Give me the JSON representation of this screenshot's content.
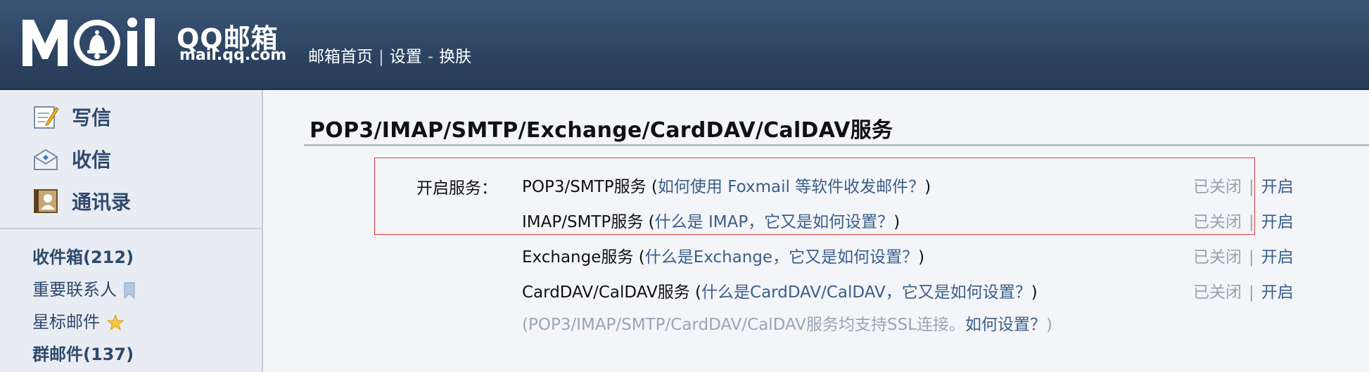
{
  "header": {
    "logo_text": "MOIL",
    "logo_cn": "QQ邮箱",
    "logo_domain": "mail.qq.com",
    "nav": [
      "邮箱首页",
      "设置",
      "换肤"
    ],
    "nav_sep_1": "|",
    "nav_sep_2": "-"
  },
  "sidebar": {
    "actions": [
      {
        "label": "写信",
        "icon": "compose-icon"
      },
      {
        "label": "收信",
        "icon": "inbox-envelope-icon"
      },
      {
        "label": "通讯录",
        "icon": "contacts-icon"
      }
    ],
    "folders": [
      {
        "label": "收件箱(212)",
        "bold": true
      },
      {
        "label": "重要联系人",
        "bold": false,
        "icon": "bookmark-icon"
      },
      {
        "label": "星标邮件",
        "bold": false,
        "icon": "star-icon"
      },
      {
        "label": "群邮件(137)",
        "bold": true
      }
    ]
  },
  "main": {
    "title": "POP3/IMAP/SMTP/Exchange/CardDAV/CalDAV服务",
    "service_label": "开启服务：",
    "services": [
      {
        "name": "POP3/SMTP服务",
        "open_paren": " (",
        "link": "如何使用 Foxmail 等软件收发邮件？",
        "close_paren": ")",
        "status": "已关闭",
        "action": "开启"
      },
      {
        "name": "IMAP/SMTP服务",
        "open_paren": " (",
        "link": "什么是 IMAP，它又是如何设置？",
        "close_paren": ")",
        "status": "已关闭",
        "action": "开启"
      },
      {
        "name": "Exchange服务",
        "open_paren": " (",
        "link": "什么是Exchange，它又是如何设置？",
        "close_paren": ")",
        "status": "已关闭",
        "action": "开启"
      },
      {
        "name": "CardDAV/CalDAV服务",
        "open_paren": " (",
        "link": "什么是CardDAV/CalDAV，它又是如何设置？",
        "close_paren": ")",
        "status": "已关闭",
        "action": "开启"
      }
    ],
    "status_sep": "|",
    "ssl_note_text": "(POP3/IMAP/SMTP/CardDAV/CalDAV服务均支持SSL连接。",
    "ssl_note_link": "如何设置？",
    "ssl_note_close": ")"
  },
  "colors": {
    "header_bg": "#2d4461",
    "sidebar_bg": "#e9edf3",
    "link": "#3b5e8a",
    "highlight_border": "#e03a3a"
  }
}
